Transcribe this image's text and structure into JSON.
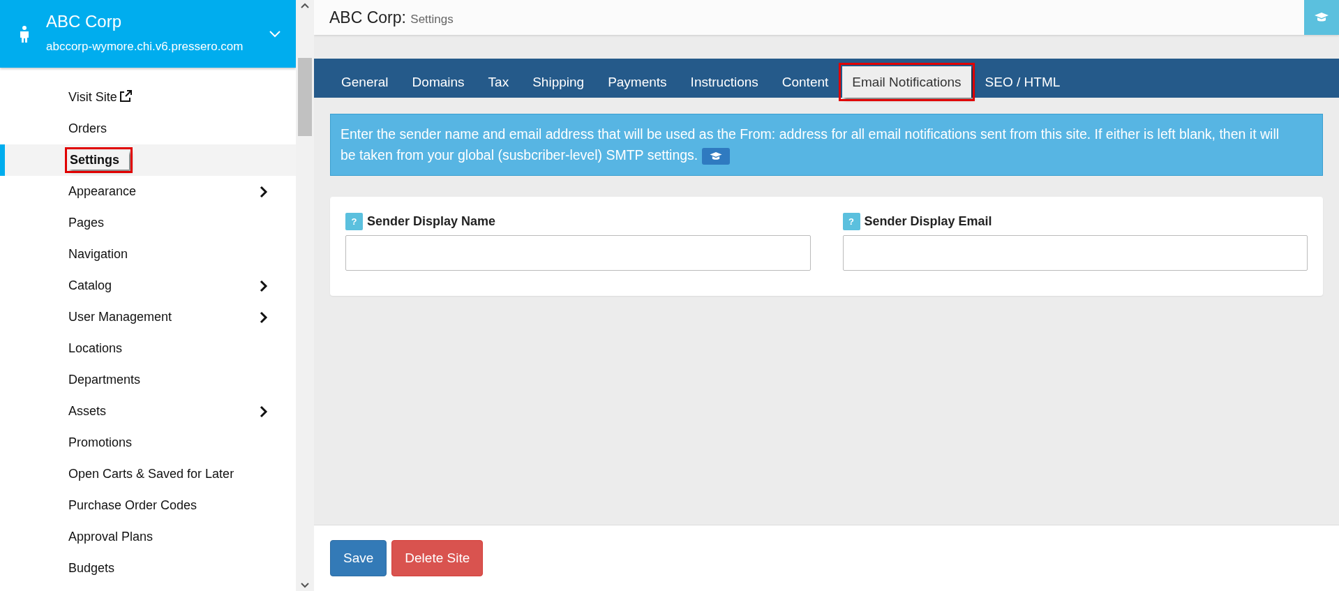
{
  "site": {
    "name": "ABC Corp",
    "domain": "abccorp-wymore.chi.v6.pressero.com"
  },
  "sidebar": {
    "items": [
      {
        "label": "Visit Site",
        "kind": "external",
        "selected": false,
        "highlighted": false
      },
      {
        "label": "Orders",
        "kind": "plain",
        "selected": false,
        "highlighted": false
      },
      {
        "label": "Settings",
        "kind": "plain",
        "selected": true,
        "highlighted": true
      },
      {
        "label": "Appearance",
        "kind": "submenu",
        "selected": false,
        "highlighted": false
      },
      {
        "label": "Pages",
        "kind": "plain",
        "selected": false,
        "highlighted": false
      },
      {
        "label": "Navigation",
        "kind": "plain",
        "selected": false,
        "highlighted": false
      },
      {
        "label": "Catalog",
        "kind": "submenu",
        "selected": false,
        "highlighted": false
      },
      {
        "label": "User Management",
        "kind": "submenu",
        "selected": false,
        "highlighted": false
      },
      {
        "label": "Locations",
        "kind": "plain",
        "selected": false,
        "highlighted": false
      },
      {
        "label": "Departments",
        "kind": "plain",
        "selected": false,
        "highlighted": false
      },
      {
        "label": "Assets",
        "kind": "submenu",
        "selected": false,
        "highlighted": false
      },
      {
        "label": "Promotions",
        "kind": "plain",
        "selected": false,
        "highlighted": false
      },
      {
        "label": "Open Carts & Saved for Later",
        "kind": "plain",
        "selected": false,
        "highlighted": false
      },
      {
        "label": "Purchase Order Codes",
        "kind": "plain",
        "selected": false,
        "highlighted": false
      },
      {
        "label": "Approval Plans",
        "kind": "plain",
        "selected": false,
        "highlighted": false
      },
      {
        "label": "Budgets",
        "kind": "plain",
        "selected": false,
        "highlighted": false
      }
    ]
  },
  "page": {
    "title": "ABC Corp:",
    "subtitle": "Settings"
  },
  "tabs": [
    {
      "label": "General",
      "selected": false,
      "highlighted": false
    },
    {
      "label": "Domains",
      "selected": false,
      "highlighted": false
    },
    {
      "label": "Tax",
      "selected": false,
      "highlighted": false
    },
    {
      "label": "Shipping",
      "selected": false,
      "highlighted": false
    },
    {
      "label": "Payments",
      "selected": false,
      "highlighted": false
    },
    {
      "label": "Instructions",
      "selected": false,
      "highlighted": false
    },
    {
      "label": "Content",
      "selected": false,
      "highlighted": false
    },
    {
      "label": "Email Notifications",
      "selected": true,
      "highlighted": true
    },
    {
      "label": "SEO / HTML",
      "selected": false,
      "highlighted": false
    }
  ],
  "info": "Enter the sender name and email address that will be used as the From: address for all email notifications sent from this site. If either is left blank, then it will be taken from your global (susbcriber-level) SMTP settings.",
  "fields": [
    {
      "help": "?",
      "label": "Sender Display Name"
    },
    {
      "help": "?",
      "label": "Sender Display Email"
    }
  ],
  "buttons": [
    {
      "label": "Save",
      "kind": "primary"
    },
    {
      "label": "Delete Site",
      "kind": "danger"
    }
  ]
}
